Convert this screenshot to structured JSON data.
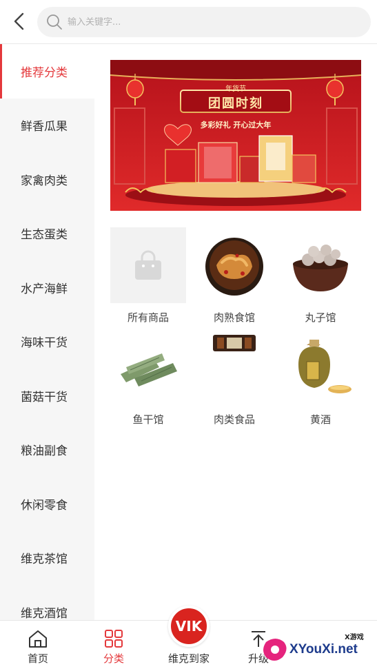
{
  "search": {
    "placeholder": "输入关键字..."
  },
  "sidebar": {
    "items": [
      {
        "label": "推荐分类",
        "active": true
      },
      {
        "label": "鲜香瓜果"
      },
      {
        "label": "家禽肉类"
      },
      {
        "label": "生态蛋类"
      },
      {
        "label": "水产海鲜"
      },
      {
        "label": "海味干货"
      },
      {
        "label": "菌菇干货"
      },
      {
        "label": "粮油副食"
      },
      {
        "label": "休闲零食"
      },
      {
        "label": "维克茶馆"
      },
      {
        "label": "维克酒馆"
      }
    ]
  },
  "banner": {
    "badge": "年货节",
    "title": "团圆时刻",
    "subtitle": "多彩好礼 开心过大年"
  },
  "grid": {
    "items": [
      {
        "label": "所有商品",
        "icon": "bag-icon"
      },
      {
        "label": "肉熟食馆",
        "icon": "braised-meat-image"
      },
      {
        "label": "丸子馆",
        "icon": "meatballs-image"
      },
      {
        "label": "鱼干馆",
        "icon": "dried-fish-image"
      },
      {
        "label": "肉类食品",
        "icon": "sausage-pack-image"
      },
      {
        "label": "黄酒",
        "icon": "yellow-wine-jar-image"
      }
    ]
  },
  "tabbar": {
    "items": [
      {
        "label": "首页",
        "icon": "home-icon"
      },
      {
        "label": "分类",
        "icon": "category-icon",
        "active": true
      },
      {
        "label": "维克到家",
        "icon": "vik-logo"
      },
      {
        "label": "升级",
        "icon": "upgrade-icon"
      }
    ],
    "vik_logo_text": "VIK"
  },
  "watermark": {
    "text": "XYouXi.net",
    "small": "X游戏"
  },
  "colors": {
    "accent": "#e4393c",
    "banner": "#c8161d"
  }
}
